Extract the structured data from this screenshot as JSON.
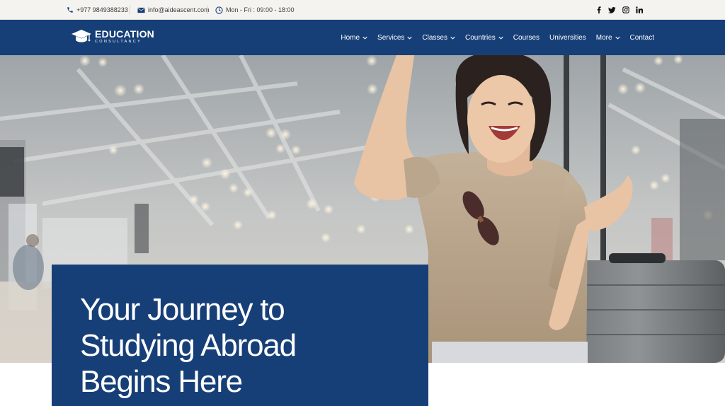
{
  "topbar": {
    "phone": "+977 9849388233",
    "email": "info@aideascent.com",
    "hours": "Mon - Fri : 09:00 - 18:00",
    "social": [
      "facebook-icon",
      "twitter-icon",
      "instagram-icon",
      "linkedin-icon"
    ]
  },
  "brand": {
    "name": "EDUCATION",
    "tagline": "CONSULTANCY"
  },
  "nav": {
    "items": [
      {
        "label": "Home",
        "dropdown": true
      },
      {
        "label": "Services",
        "dropdown": true
      },
      {
        "label": "Classes",
        "dropdown": true
      },
      {
        "label": "Countries",
        "dropdown": true
      },
      {
        "label": "Courses",
        "dropdown": false
      },
      {
        "label": "Universities",
        "dropdown": false
      },
      {
        "label": "More",
        "dropdown": true
      },
      {
        "label": "Contact",
        "dropdown": false
      }
    ]
  },
  "hero": {
    "title_lines": [
      "Your Journey to",
      "Studying Abroad",
      "Begins Here"
    ]
  },
  "colors": {
    "primary": "#173f77",
    "topbar_bg": "#f5f3ef",
    "text_dark": "#3c3c3c"
  }
}
